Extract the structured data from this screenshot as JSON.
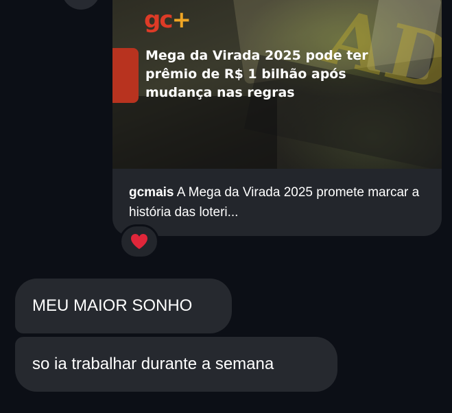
{
  "post": {
    "logo_main": "gc",
    "logo_plus": "+",
    "headline": "Mega da Virada 2025 pode ter prêmio de R$ 1 bilhão após mudança nas regras",
    "username": "gcmais",
    "caption": "A Mega da Virada 2025 promete marcar a história das loteri...",
    "image_letters": "ADA"
  },
  "reaction": {
    "emoji": "heart-icon",
    "color": "#e0263a"
  },
  "messages": [
    {
      "text": "MEU MAIOR SONHO"
    },
    {
      "text": "so ia trabalhar durante a semana"
    }
  ],
  "colors": {
    "background": "#0c0f16",
    "bubble": "#26292f",
    "logo_red": "#dd3b27",
    "logo_orange": "#f0a625"
  }
}
